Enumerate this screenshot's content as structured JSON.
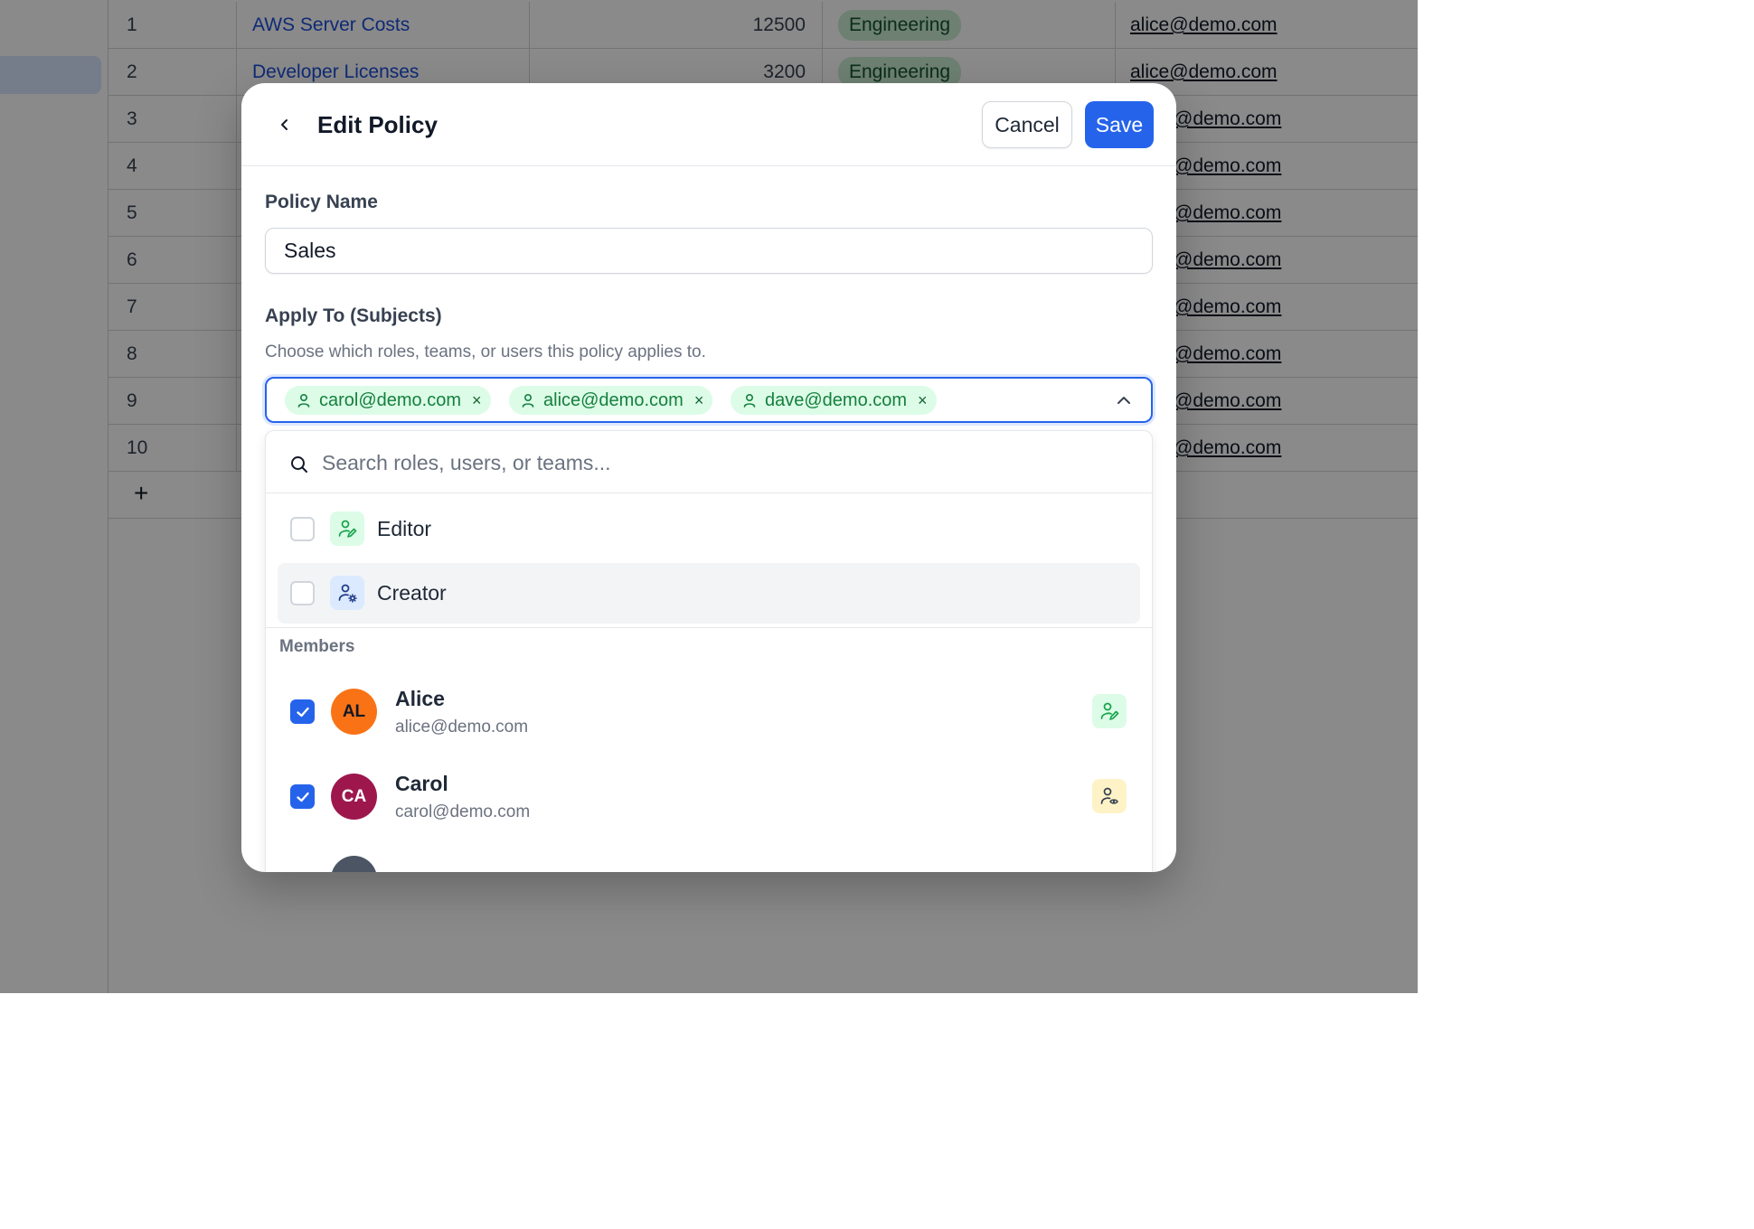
{
  "background_table": {
    "rows": [
      {
        "num": "1",
        "name": "AWS Server Costs",
        "amount": "12500",
        "dept": "Engineering",
        "email": "alice@demo.com"
      },
      {
        "num": "2",
        "name": "Developer Licenses",
        "amount": "3200",
        "dept": "Engineering",
        "email": "alice@demo.com"
      },
      {
        "num": "3",
        "name": "",
        "amount": "",
        "dept": "",
        "email": "@demo.com"
      },
      {
        "num": "4",
        "name": "",
        "amount": "",
        "dept": "",
        "email": "@demo.com"
      },
      {
        "num": "5",
        "name": "",
        "amount": "",
        "dept": "",
        "email": "@demo.com"
      },
      {
        "num": "6",
        "name": "",
        "amount": "",
        "dept": "",
        "email": "@demo.com"
      },
      {
        "num": "7",
        "name": "",
        "amount": "",
        "dept": "",
        "email": "@demo.com"
      },
      {
        "num": "8",
        "name": "",
        "amount": "",
        "dept": "",
        "email": "@demo.com"
      },
      {
        "num": "9",
        "name": "",
        "amount": "",
        "dept": "",
        "email": "@demo.com"
      },
      {
        "num": "10",
        "name": "",
        "amount": "",
        "dept": "",
        "email": "@demo.com"
      }
    ],
    "add_row_label": "+"
  },
  "modal": {
    "title": "Edit Policy",
    "cancel_label": "Cancel",
    "save_label": "Save",
    "policy_name_label": "Policy Name",
    "policy_name_value": "Sales",
    "subjects_label": "Apply To (Subjects)",
    "subjects_helper": "Choose which roles, teams, or users this policy applies to.",
    "selected_chips": [
      {
        "label": "carol@demo.com",
        "icon": "user-icon"
      },
      {
        "label": "alice@demo.com",
        "icon": "user-icon"
      },
      {
        "label": "dave@demo.com",
        "icon": "user-icon"
      }
    ],
    "chip_remove": "×",
    "dropdown": {
      "search_placeholder": "Search roles, users, or teams...",
      "roles": [
        {
          "label": "Editor",
          "icon": "user-edit-icon",
          "checked": false,
          "color": "#16a34a"
        },
        {
          "label": "Creator",
          "icon": "user-gear-icon",
          "checked": false,
          "color": "#1e3a8a"
        }
      ],
      "members_title": "Members",
      "members": [
        {
          "initials": "AL",
          "name": "Alice",
          "email": "alice@demo.com",
          "checked": true,
          "avatar_color": "#f97316",
          "role_icon": "user-edit-icon"
        },
        {
          "initials": "CA",
          "name": "Carol",
          "email": "carol@demo.com",
          "checked": true,
          "avatar_color": "#9d174d",
          "role_icon": "user-view-icon"
        }
      ]
    }
  },
  "colors": {
    "accent": "#2563eb",
    "chip_bg": "#dcfce7",
    "chip_text": "#15803d",
    "badge_bg": "#c9ecd3"
  }
}
